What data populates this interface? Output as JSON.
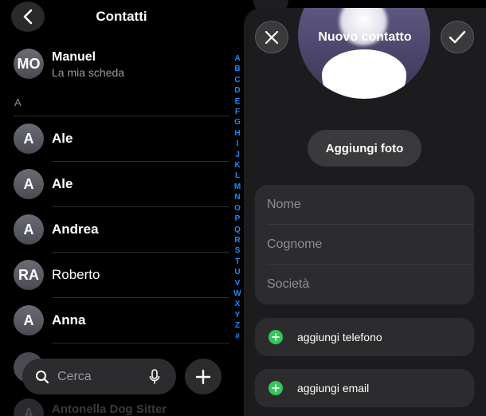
{
  "contacts_panel": {
    "title": "Contatti",
    "my_card": {
      "initials": "MO",
      "name": "Manuel",
      "subtitle": "La mia scheda"
    },
    "section_header": "A",
    "contacts": [
      {
        "initials": "A",
        "name": "Ale"
      },
      {
        "initials": "A",
        "name": "Ale"
      },
      {
        "initials": "A",
        "name": "Andrea"
      },
      {
        "initials": "RA",
        "name": "Roberto"
      },
      {
        "initials": "A",
        "name": "Anna"
      }
    ],
    "partial_contact": {
      "initials": "A",
      "name": "Antonella Dog Sitter"
    },
    "index_letters": [
      "A",
      "B",
      "C",
      "D",
      "E",
      "F",
      "G",
      "H",
      "I",
      "J",
      "K",
      "L",
      "M",
      "N",
      "O",
      "P",
      "Q",
      "R",
      "S",
      "T",
      "U",
      "V",
      "W",
      "X",
      "Y",
      "Z",
      "#"
    ],
    "search": {
      "placeholder": "Cerca"
    },
    "icons": {
      "back": "chevron-left-icon",
      "search": "search-icon",
      "mic": "microphone-icon",
      "add": "plus-icon"
    }
  },
  "new_contact_sheet": {
    "title": "Nuovo contatto",
    "add_photo_label": "Aggiungi foto",
    "fields": [
      {
        "placeholder": "Nome"
      },
      {
        "placeholder": "Cognome"
      },
      {
        "placeholder": "Società"
      }
    ],
    "actions": [
      {
        "label": "aggiungi telefono"
      },
      {
        "label": "aggiungi email"
      }
    ],
    "icons": {
      "cancel": "close-icon",
      "done": "checkmark-icon",
      "add_field": "plus-circle-icon"
    }
  },
  "colors": {
    "background": "#000000",
    "sheet_background": "#1c1c1e",
    "index_accent": "#1a8cff",
    "add_green": "#34c759"
  }
}
